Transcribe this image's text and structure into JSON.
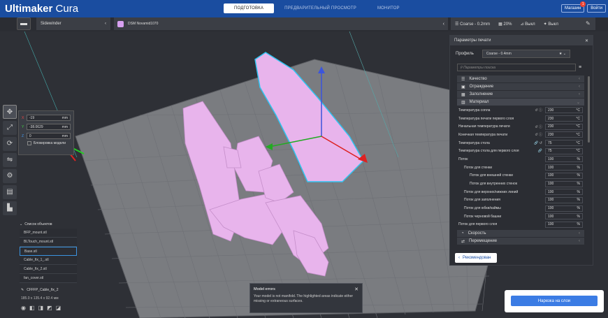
{
  "app": {
    "brand_bold": "Ultimaker",
    "brand_light": "Cura"
  },
  "stages": [
    {
      "label": "ПОДГОТОВКА"
    },
    {
      "label": "ПРЕДВАРИТЕЛЬНЫЙ ПРОСМОТР"
    },
    {
      "label": "МОНИТОР"
    }
  ],
  "top_right": {
    "marketplace": "Магазин",
    "marketplace_badge": "1",
    "signin": "Войти"
  },
  "printer": {
    "name": "Sidewinder",
    "chevron": "‹"
  },
  "material": {
    "name": "DSM Novamid1070",
    "chevron": "‹"
  },
  "settings_summary": {
    "profile": "Coarse - 0.2mm",
    "infill": "20%",
    "support": "Выкл",
    "adhesion": "Выкл"
  },
  "move_tool": {
    "x_label": "X",
    "x_value": "-19",
    "x_unit": "mm",
    "y_label": "Y",
    "y_value": "-38.0629",
    "y_unit": "mm",
    "z_label": "Z",
    "z_value": "0",
    "z_unit": "mm",
    "lock_label": "Блокировка модели"
  },
  "object_list": {
    "header": "Список объектов",
    "items": [
      "BFP_mount.stl",
      "BLTouch_mount.stl",
      "Base.stl",
      "Cable_fix_1_.stl",
      "Cable_fix_2.stl",
      "fan_cover.stl"
    ],
    "selected_index": 2
  },
  "selected_object": {
    "name": "CFFFP_Cable_fix_2",
    "dims": "185.0 x 135.4 x 92.4 мм"
  },
  "print_settings": {
    "title": "Параметры печати",
    "profile_label": "Профиль",
    "profile_value": "Coarse - 0.4mm",
    "search_placeholder": "Параметры поиска",
    "categories": [
      {
        "label": "Качество"
      },
      {
        "label": "Ограждение"
      },
      {
        "label": "Заполнение"
      },
      {
        "label": "Материал"
      }
    ],
    "bottom_categories": [
      {
        "label": "Скорость"
      },
      {
        "label": "Перемещение"
      }
    ],
    "settings": [
      {
        "label": "Температура сопла",
        "icon": "↺ ⓘ",
        "value": "230",
        "unit": "°C"
      },
      {
        "label": "Температура печати первого слоя",
        "icon": "",
        "value": "230",
        "unit": "°C"
      },
      {
        "label": "Начальная температура печати",
        "icon": "↺ ⓘ",
        "value": "230",
        "unit": "°C"
      },
      {
        "label": "Конечная температура печати",
        "icon": "↺ ⓘ",
        "value": "230",
        "unit": "°C"
      },
      {
        "label": "Температура стола",
        "icon": "🔗 ↺",
        "value": "75",
        "unit": "°C"
      },
      {
        "label": "Температура стола для первого слоя",
        "icon": "🔗",
        "value": "75",
        "unit": "°C"
      },
      {
        "label": "Поток",
        "icon": "",
        "value": "100",
        "unit": "%"
      },
      {
        "label": "Поток для стенки",
        "icon": "",
        "value": "100",
        "unit": "%"
      },
      {
        "label": "Поток для внешней стенки",
        "icon": "",
        "value": "100",
        "unit": "%"
      },
      {
        "label": "Поток для внутренних стенок",
        "icon": "",
        "value": "100",
        "unit": "%"
      },
      {
        "label": "Поток для верхних/нижних линий",
        "icon": "",
        "value": "100",
        "unit": "%"
      },
      {
        "label": "Поток для заполнения",
        "icon": "",
        "value": "100",
        "unit": "%"
      },
      {
        "label": "Поток для юбки/каймы",
        "icon": "",
        "value": "100",
        "unit": "%"
      },
      {
        "label": "Поток черновой башни",
        "icon": "",
        "value": "100",
        "unit": "%"
      },
      {
        "label": "Поток для первого слоя",
        "icon": "",
        "value": "100",
        "unit": "%"
      }
    ],
    "recommended": "Рекомендован"
  },
  "model_errors": {
    "title": "Model errors",
    "text": "Your model is not manifold. The highlighted areas indicate either missing or extraneous surfaces."
  },
  "slice_button": "Нарезка на слои",
  "colors": {
    "topbar": "#1a4da0",
    "model": "#e8b4ec",
    "accent": "#3b7ce4"
  }
}
